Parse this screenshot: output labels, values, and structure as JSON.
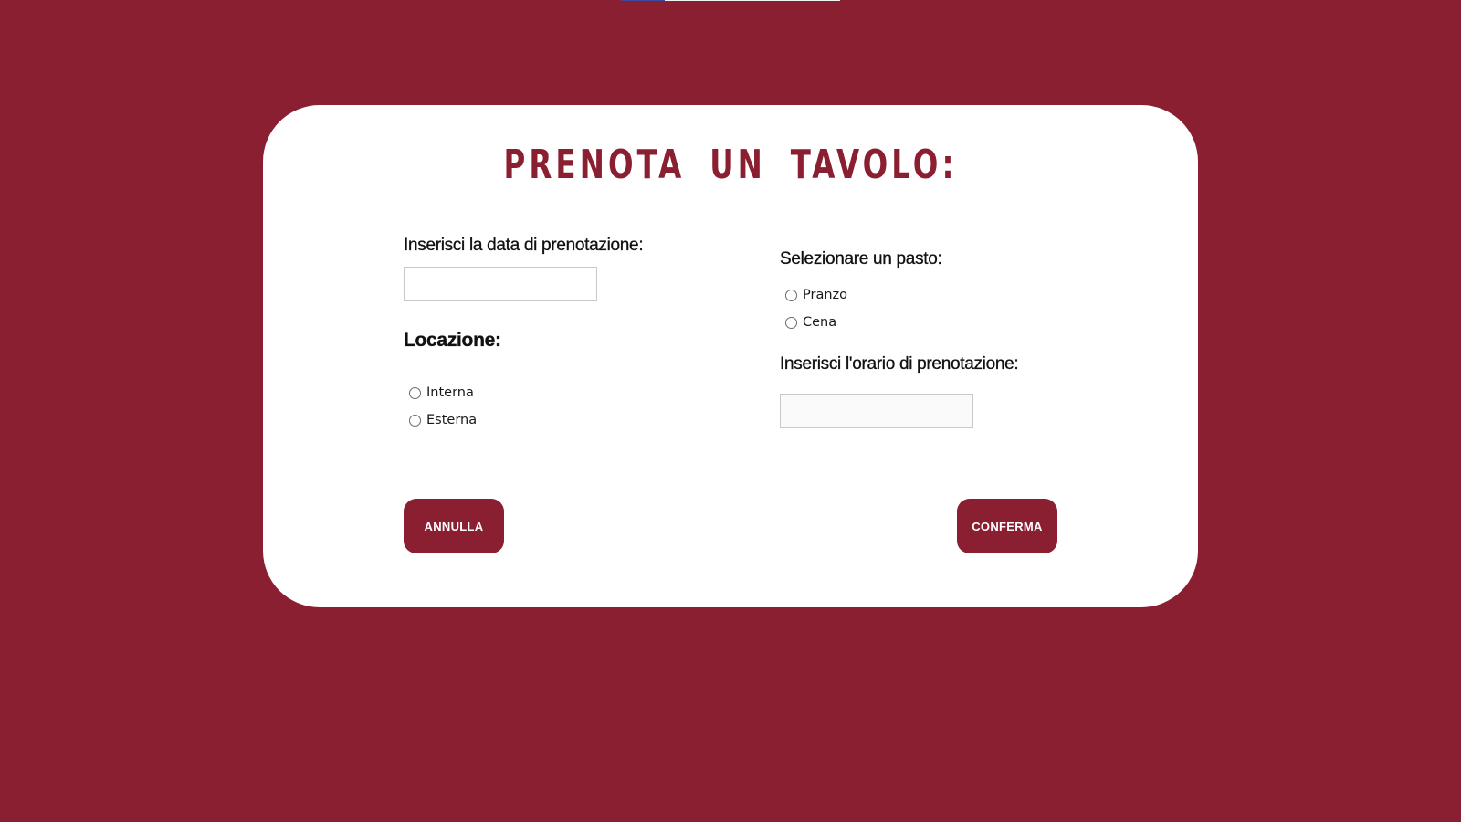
{
  "colors": {
    "background": "#8a1f31",
    "card": "#ffffff",
    "accent": "#8a1f31"
  },
  "form": {
    "title": "PRENOTA UN TAVOLO:",
    "date": {
      "label": "Inserisci la data di prenotazione:",
      "value": ""
    },
    "location": {
      "label": "Locazione:",
      "options": [
        "Interna",
        "Esterna"
      ]
    },
    "meal": {
      "label": "Selezionare un pasto:",
      "options": [
        "Pranzo",
        "Cena"
      ]
    },
    "time": {
      "label": "Inserisci l'orario di prenotazione:",
      "value": ""
    },
    "buttons": {
      "cancel": "ANNULLA",
      "confirm": "CONFERMA"
    }
  }
}
